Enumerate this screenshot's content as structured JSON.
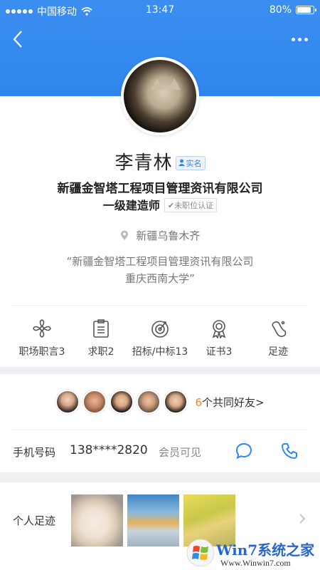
{
  "status_bar": {
    "carrier": "中国移动",
    "time": "13:47",
    "battery": "80%",
    "battery_level": 0.8
  },
  "profile": {
    "name": "李青林",
    "verified_label": "实名",
    "company": "新疆金智塔工程项目管理资讯有限公司",
    "job_title": "一级建造师",
    "cert_status": "✔未职位认证",
    "location": "新疆乌鲁木齐",
    "quote_line1": "“新疆金智塔工程项目管理资讯有限公司",
    "quote_line2": "重庆西南大学”"
  },
  "stats": [
    {
      "label": "职场职言3",
      "icon": "pinwheel-icon"
    },
    {
      "label": "求职2",
      "icon": "clipboard-icon"
    },
    {
      "label": "招标/中标13",
      "icon": "target-icon"
    },
    {
      "label": "证书3",
      "icon": "medal-icon"
    },
    {
      "label": "足迹",
      "icon": "footprint-icon"
    }
  ],
  "friends": {
    "count": "6",
    "label": "个共同好友>"
  },
  "contact": {
    "label": "手机号码",
    "value": "138****2820",
    "note": "会员可见"
  },
  "footprint": {
    "label": "个人足迹"
  },
  "watermark": {
    "brand": "Win7系统之家",
    "url": "Www.Winwin7.com"
  },
  "colors": {
    "header_blue": "#2f86ee",
    "accent_orange": "#f08a1c",
    "icon_blue": "#2f86ee"
  }
}
